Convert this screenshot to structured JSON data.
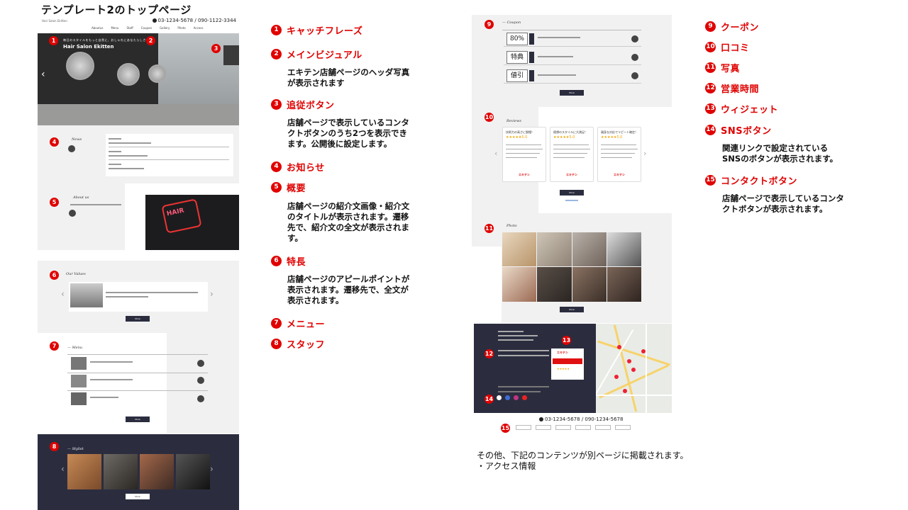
{
  "title": "テンプレート2のトップページ",
  "mock": {
    "logo": "Hair Salon Ekitten",
    "phone": "03-1234-5678 / 090-1122-3344",
    "nav": [
      "Aboutus",
      "Menu",
      "Staff",
      "Coupon",
      "Gallery",
      "Photo",
      "Access"
    ],
    "hero_catch": "毎日のスタイルをもっと自然に、おしゃれにあなたらしさを",
    "hero_salon": "Hair Salon Ekitten",
    "news_heading": "News",
    "about_heading": "About us",
    "values_heading": "Our Values",
    "menu_heading": "— Menu",
    "stylist_heading": "— Stylist",
    "coupon_heading": "— Coupon",
    "reviews_heading": "Reviews",
    "photo_heading": "Photo",
    "more_label": "More",
    "coupon_values": [
      "80%",
      "特典",
      "値引"
    ],
    "review_titles": [
      "技術力の高さに脱帽！",
      "理想のスタイルに大満足！",
      "親身な対応でリピート確定！"
    ],
    "review_stars": "★★★★★5.0",
    "review_brand": "エキテン",
    "widget_brand": "エキテン",
    "widget_stars": "★★★★★",
    "footer_phone": "03-1234-5678 / 090-1234-5678"
  },
  "items": [
    {
      "num": "1",
      "label": "キャッチフレーズ"
    },
    {
      "num": "2",
      "label": "メインビジュアル",
      "desc": "エキテン店舗ページのヘッダ写真\nが表示されます"
    },
    {
      "num": "3",
      "label": "追従ボタン",
      "desc": "店舗ページで表示しているコンタ\nクトボタンのうち2つを表示でき\nます。公開後に設定します。"
    },
    {
      "num": "4",
      "label": "お知らせ"
    },
    {
      "num": "5",
      "label": "概要",
      "desc": "店舗ページの紹介文画像・紹介文\nのタイトルが表示されます。遷移\n先で、紹介文の全文が表示されま\nす。"
    },
    {
      "num": "6",
      "label": "特長",
      "desc": "店舗ページのアピールポイントが\n表示されます。遷移先で、全文が\n表示されます。"
    },
    {
      "num": "7",
      "label": "メニュー"
    },
    {
      "num": "8",
      "label": "スタッフ"
    }
  ],
  "right_items": [
    {
      "num": "9",
      "label": "クーポン"
    },
    {
      "num": "10",
      "label": "口コミ"
    },
    {
      "num": "11",
      "label": "写真"
    },
    {
      "num": "12",
      "label": "営業時間"
    },
    {
      "num": "13",
      "label": "ウィジェット"
    },
    {
      "num": "14",
      "label": "SNSボタン",
      "desc": "関連リンクで設定されている\nSNSのボタンが表示されます。"
    },
    {
      "num": "15",
      "label": "コンタクトボタン",
      "desc": "店舗ページで表示しているコンタ\nクトボタンが表示されます。"
    }
  ],
  "note": "その他、下記のコンテンツが別ページに掲載されます。\n・アクセス情報",
  "colors": {
    "accent": "#e00000",
    "dark": "#2b2d3f"
  }
}
